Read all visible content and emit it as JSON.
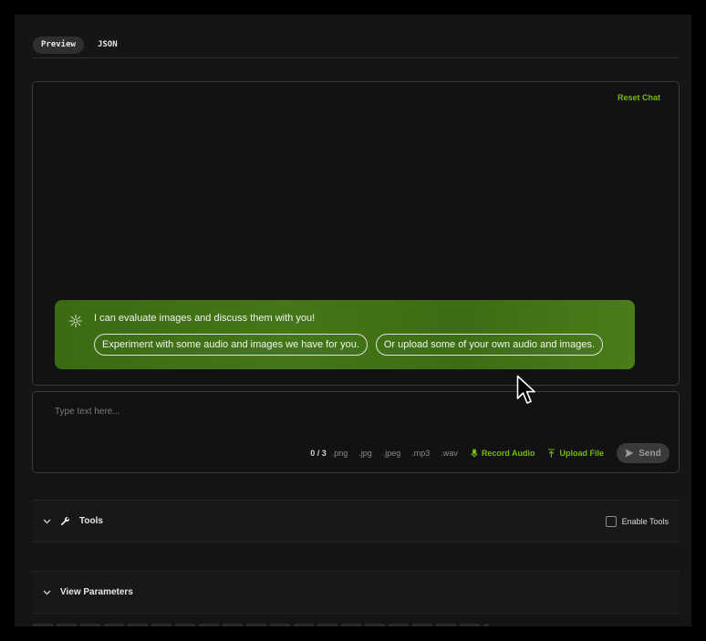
{
  "tabs": [
    {
      "label": "Preview",
      "active": true
    },
    {
      "label": "JSON",
      "active": false
    }
  ],
  "chat": {
    "reset_label": "Reset Chat",
    "greeting": {
      "icon": "sparkle-icon",
      "text": "I can evaluate images and discuss them with you!",
      "suggestions": [
        "Experiment with some audio and images we have for you.",
        "Or upload some of your own audio and images."
      ]
    }
  },
  "input": {
    "placeholder": "Type text here...",
    "value": "",
    "attachment_count": "0 / 3",
    "file_types": [
      ".png",
      ".jpg",
      ".jpeg",
      ".mp3",
      ".wav"
    ],
    "record_audio_label": "Record Audio",
    "upload_file_label": "Upload File",
    "send_label": "Send"
  },
  "tools": {
    "title": "Tools",
    "enable_label": "Enable Tools",
    "enabled": false
  },
  "parameters": {
    "title": "View Parameters"
  },
  "colors": {
    "accent": "#76b900",
    "background": "#151516",
    "panel": "#121214",
    "greeting_bg": "#447717"
  }
}
